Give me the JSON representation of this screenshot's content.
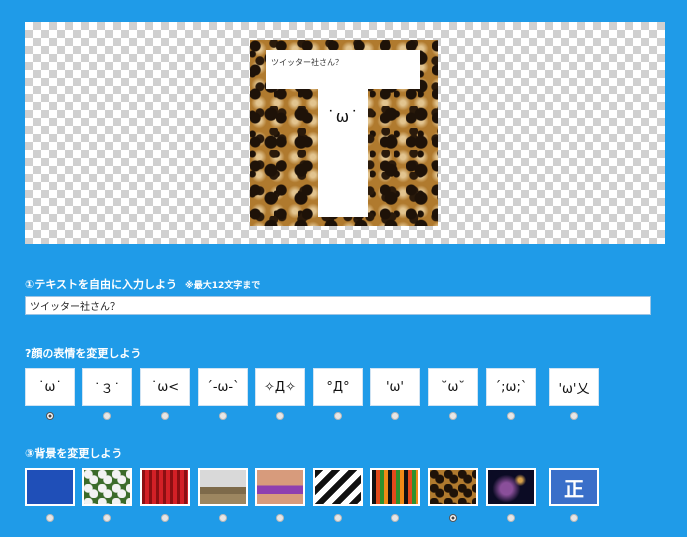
{
  "preview": {
    "caption_text": "ツイッター社さん？",
    "face_text": "˙ω˙"
  },
  "section1": {
    "heading": "①テキストを自由に入力しよう",
    "note": "※最大12文字まで",
    "input_value": "ツイッター社さん？"
  },
  "section2": {
    "heading": "?顔の表情を変更しよう",
    "faces": [
      "˙ω˙",
      "˙３˙",
      "˙ω<",
      "´-ω-`",
      "✧Д✧",
      "°Д°",
      "'ω'",
      "˘ω˘",
      "´;ω;`",
      "'ω'乂"
    ],
    "selected_index": 0
  },
  "section3": {
    "heading": "③背景を変更しよう",
    "backgrounds": [
      {
        "name": "blue",
        "color": "#1f4fb8"
      },
      {
        "name": "green-pattern",
        "color": "#3b6b2a"
      },
      {
        "name": "red-curtain",
        "color": "#b5171c"
      },
      {
        "name": "field-landscape",
        "color": "#a88f6a"
      },
      {
        "name": "bikini",
        "color": "#d79b7c"
      },
      {
        "name": "black-white-stripes",
        "color": "#111111"
      },
      {
        "name": "colorful-stripes",
        "color": "#e24a1b"
      },
      {
        "name": "leopard",
        "color": "#b07a2e"
      },
      {
        "name": "galaxy",
        "color": "#0b0b24"
      },
      {
        "name": "kanji",
        "color": "#3a6fc9",
        "label": "正"
      }
    ],
    "selected_index": 7
  }
}
